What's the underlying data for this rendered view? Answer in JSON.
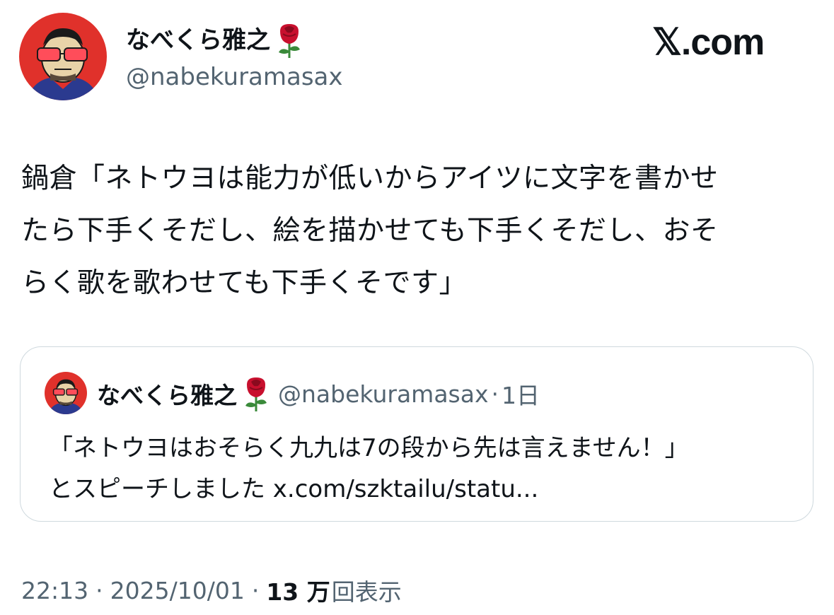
{
  "author": {
    "display_name": "なべくら雅之",
    "handle": "@nabekuramasax",
    "emoji_icon": "rose-icon"
  },
  "platform": {
    "logo_text": "𝕏.com"
  },
  "tweet": {
    "text_lines": [
      "鍋倉「ネトウヨは能力が低いからアイツに文字を書かせ",
      "たら下手くそだし、絵を描かせても下手くそだし、おそ",
      "らく歌を歌わせても下手くそです」"
    ]
  },
  "quote": {
    "display_name": "なべくら雅之",
    "handle": "@nabekuramasax",
    "separator": "·",
    "relative_time": "1日",
    "text_lines": [
      "「ネトウヨはおそらく九九は7の段から先は言えません！」",
      "とスピーチしました x.com/szktailu/statu..."
    ]
  },
  "meta": {
    "time": "22:13",
    "separator": "·",
    "date": "2025/10/01",
    "views_count": "13 万",
    "views_label": "回表示"
  },
  "colors": {
    "text_primary": "#0f1419",
    "text_secondary": "#536471",
    "border": "#cfd9de",
    "avatar_bg": "#e0312b",
    "rose": "#c8102e"
  }
}
